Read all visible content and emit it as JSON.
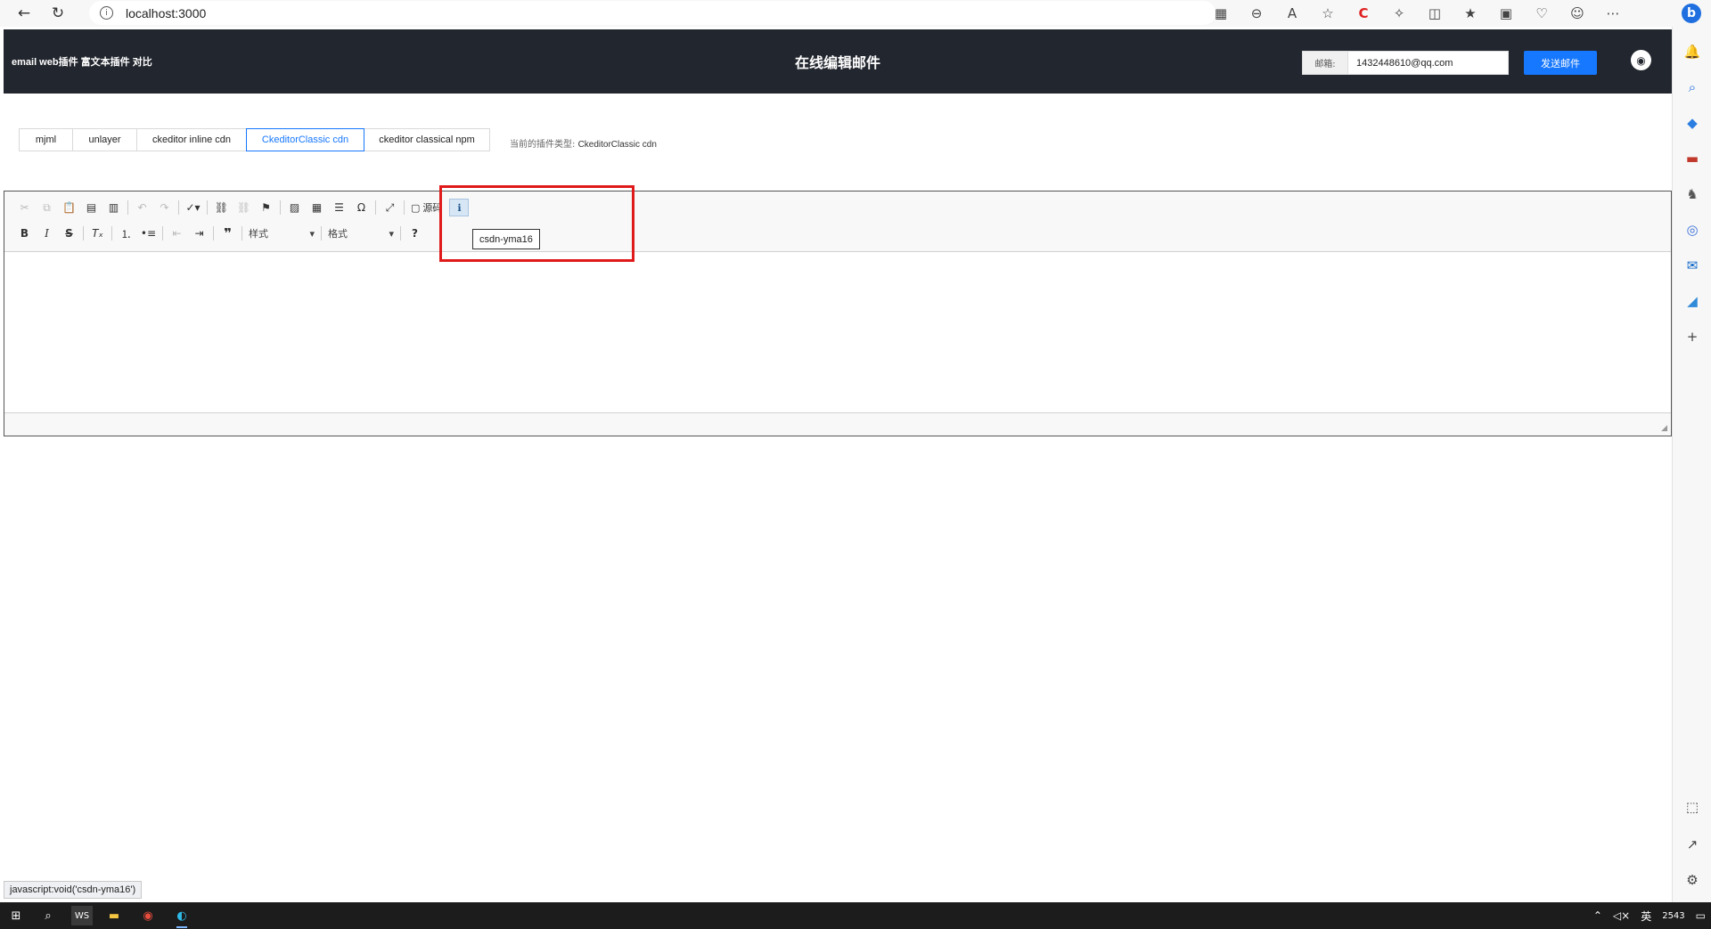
{
  "browser": {
    "url": "localhost:3000"
  },
  "app": {
    "brand": "email web插件 富文本插件 对比",
    "title": "在线编辑邮件",
    "email_label": "邮箱:",
    "email_value": "1432448610@qq.com",
    "send_label": "发送邮件"
  },
  "tabs": [
    {
      "label": "mjml"
    },
    {
      "label": "unlayer"
    },
    {
      "label": "ckeditor inline cdn"
    },
    {
      "label": "CkeditorClassic cdn"
    },
    {
      "label": "ckeditor classical npm"
    }
  ],
  "current_type": {
    "label": "当前的插件类型:",
    "value": "CkeditorClassic cdn"
  },
  "editor": {
    "source_label": "源码",
    "styles_combo": "样式",
    "format_combo": "格式",
    "tooltip": "csdn-yma16"
  },
  "status_link": "javascript:void('csdn-yma16')",
  "taskbar": {
    "ime": "英",
    "clock": "2543"
  },
  "colors": {
    "header_bg": "#22262e",
    "accent": "#1677ff",
    "highlight_border": "#e01a1a"
  }
}
